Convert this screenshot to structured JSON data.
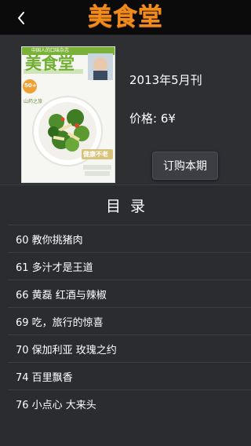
{
  "header": {
    "logo_text": "美食堂",
    "back_icon": "chevron-left-icon"
  },
  "cover": {
    "masthead": "美食堂",
    "top_banner": "中国人的口味杂志",
    "badge": "50+",
    "tag_left": "山药之旅",
    "headline": "健康不老"
  },
  "issue": {
    "title": "2013年5月刊",
    "price": "价格: 6¥",
    "buy_label": "订购本期"
  },
  "toc": {
    "title": "目录",
    "items": [
      {
        "label": "60 教你挑猪肉"
      },
      {
        "label": "61 多汁才是王道"
      },
      {
        "label": "66 黄磊 红酒与辣椒"
      },
      {
        "label": "69 吃，旅行的惊喜"
      },
      {
        "label": "70 保加利亚  玫瑰之约"
      },
      {
        "label": "74 百里飘香"
      },
      {
        "label": "76 小点心  大来头"
      }
    ]
  },
  "colors": {
    "nav_bg": "#0b0b0c",
    "page_bg": "#2b2c30",
    "logo": "#f08c1b",
    "text": "#ffffff"
  }
}
